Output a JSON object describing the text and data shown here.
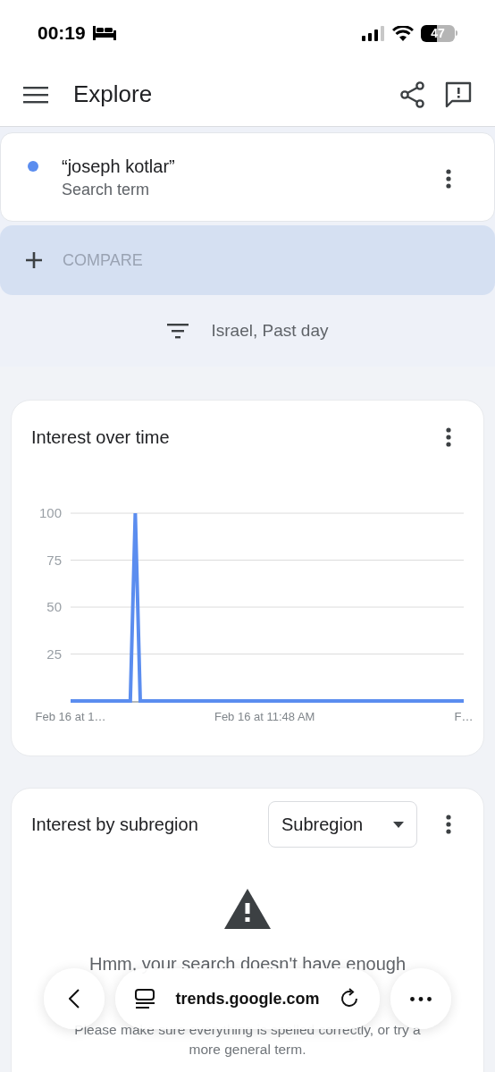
{
  "status_bar": {
    "time": "00:19",
    "battery": "47"
  },
  "header": {
    "title": "Explore"
  },
  "search_term": {
    "color": "#5b8def",
    "term": "“joseph kotlar”",
    "subtitle": "Search term"
  },
  "compare": {
    "label": "COMPARE"
  },
  "filter": {
    "label": "Israel, Past day"
  },
  "interest_over_time": {
    "title": "Interest over time",
    "chart_data": {
      "type": "line",
      "categories": [
        "Feb 16 at 1…",
        null,
        null,
        null,
        null,
        null,
        null,
        null,
        null,
        null,
        null,
        null,
        null,
        null,
        null,
        null,
        null,
        null,
        null,
        null,
        null,
        null,
        null,
        null,
        null,
        null,
        null,
        null,
        null,
        null,
        null,
        null,
        null,
        null,
        null,
        null,
        null,
        null,
        null,
        "Feb 16 at 11:48 AM",
        null,
        null,
        null,
        null,
        null,
        null,
        null,
        null,
        null,
        null,
        null,
        null,
        null,
        null,
        null,
        null,
        null,
        null,
        null,
        null,
        null,
        null,
        null,
        null,
        null,
        null,
        null,
        null,
        null,
        null,
        null,
        null,
        null,
        null,
        null,
        null,
        null,
        null,
        null,
        "F…"
      ],
      "series": [
        {
          "color": "#5b8def",
          "values": [
            0,
            0,
            0,
            0,
            0,
            0,
            0,
            0,
            0,
            0,
            0,
            0,
            0,
            100,
            0,
            0,
            0,
            0,
            0,
            0,
            0,
            0,
            0,
            0,
            0,
            0,
            0,
            0,
            0,
            0,
            0,
            0,
            0,
            0,
            0,
            0,
            0,
            0,
            0,
            0,
            0,
            0,
            0,
            0,
            0,
            0,
            0,
            0,
            0,
            0,
            0,
            0,
            0,
            0,
            0,
            0,
            0,
            0,
            0,
            0,
            0,
            0,
            0,
            0,
            0,
            0,
            0,
            0,
            0,
            0,
            0,
            0,
            0,
            0,
            0,
            0,
            0,
            0,
            0,
            0
          ]
        }
      ],
      "ylim": [
        0,
        100
      ],
      "yticks": [
        25,
        50,
        75,
        100
      ],
      "grid": true
    }
  },
  "interest_by_subregion": {
    "title": "Interest by subregion",
    "dropdown": "Subregion",
    "message": "Hmm, your search doesn't have enough",
    "hint": "Please make sure everything is spelled correctly, or try a more general term."
  },
  "browser_bar": {
    "url": "trends.google.com"
  }
}
